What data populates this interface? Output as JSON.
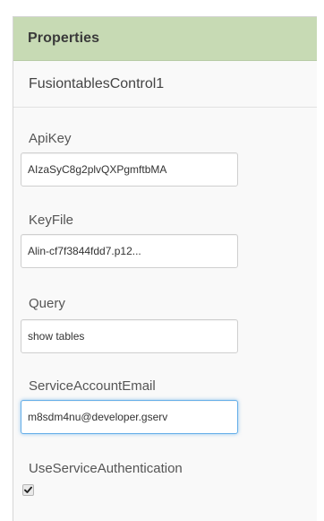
{
  "panel": {
    "title": "Properties",
    "component_name": "FusiontablesControl1"
  },
  "properties": {
    "api_key": {
      "label": "ApiKey",
      "value": "AIzaSyC8g2plvQXPgmftbMA"
    },
    "key_file": {
      "label": "KeyFile",
      "value": "Alin-cf7f3844fdd7.p12..."
    },
    "query": {
      "label": "Query",
      "value": "show tables"
    },
    "service_account_email": {
      "label": "ServiceAccountEmail",
      "value": "m8sdm4nu@developer.gserv"
    },
    "use_service_authentication": {
      "label": "UseServiceAuthentication",
      "checked": true
    }
  },
  "colors": {
    "header_background": "#c7dab4",
    "panel_background": "#f9f9f9",
    "focus_ring": "#66afe9"
  },
  "icons": {
    "checkbox_mark": "checkmark-icon"
  }
}
